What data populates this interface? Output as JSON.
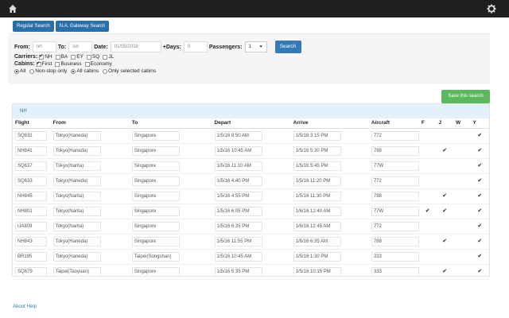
{
  "topbar": {
    "home_icon": "home-icon",
    "settings_icon": "gear-icon"
  },
  "tabs": [
    {
      "label": "Regular Search"
    },
    {
      "label": "N.A. Gateway Search"
    }
  ],
  "search": {
    "from_label": "From:",
    "from_value": "nrt",
    "to_label": "To:",
    "to_value": "sin",
    "date_label": "Date:",
    "date_value": "01/05/2016",
    "days_label": "+Days:",
    "days_value": "0",
    "passengers_label": "Passengers:",
    "passengers_value": "1",
    "search_button": "Search"
  },
  "carriers": {
    "label": "Carriers:",
    "items": [
      {
        "code": "NH",
        "checked": true
      },
      {
        "code": "BA",
        "checked": false
      },
      {
        "code": "EY",
        "checked": false
      },
      {
        "code": "SQ",
        "checked": false
      },
      {
        "code": "JL",
        "checked": false
      }
    ]
  },
  "cabins": {
    "label": "Cabins:",
    "items": [
      {
        "name": "First",
        "checked": true
      },
      {
        "name": "Business",
        "checked": false
      },
      {
        "name": "Economy",
        "checked": false
      }
    ]
  },
  "filters": {
    "stops": [
      {
        "label": "All",
        "selected": true
      },
      {
        "label": "Non-stop only",
        "selected": false
      }
    ],
    "cabin_mode": [
      {
        "label": "All cabins",
        "selected": true
      },
      {
        "label": "Only selected cabins",
        "selected": false
      }
    ]
  },
  "save_button": "Save this search",
  "results": {
    "carrier": "NH",
    "columns": [
      "Flight",
      "From",
      "To",
      "Depart",
      "Arrive",
      "Aircraft",
      "F",
      "J",
      "W",
      "Y"
    ],
    "rows": [
      {
        "flight": "SQ631",
        "from": "Tokyo(Haneda)",
        "to": "Singapore",
        "depart": "1/5/16 8:50 AM",
        "arrive": "1/5/16 3:15 PM",
        "aircraft": "772",
        "F": "",
        "J": "",
        "W": "",
        "Y": "✔"
      },
      {
        "flight": "NH841",
        "from": "Tokyo(Haneda)",
        "to": "Singapore",
        "depart": "1/5/16 10:45 AM",
        "arrive": "1/5/16 5:30 PM",
        "aircraft": "788",
        "F": "",
        "J": "✔",
        "W": "",
        "Y": "✔"
      },
      {
        "flight": "SQ637",
        "from": "Tokyo(Narita)",
        "to": "Singapore",
        "depart": "1/5/16 11:10 AM",
        "arrive": "1/5/16 5:45 PM",
        "aircraft": "77W",
        "F": "",
        "J": "",
        "W": "",
        "Y": "✔"
      },
      {
        "flight": "SQ633",
        "from": "Tokyo(Haneda)",
        "to": "Singapore",
        "depart": "1/5/16 4:40 PM",
        "arrive": "1/5/16 11:20 PM",
        "aircraft": "772",
        "F": "",
        "J": "",
        "W": "",
        "Y": "✔"
      },
      {
        "flight": "NH845",
        "from": "Tokyo(Narita)",
        "to": "Singapore",
        "depart": "1/5/16 4:55 PM",
        "arrive": "1/5/16 11:30 PM",
        "aircraft": "788",
        "F": "",
        "J": "✔",
        "W": "",
        "Y": "✔"
      },
      {
        "flight": "NH801",
        "from": "Tokyo(Narita)",
        "to": "Singapore",
        "depart": "1/5/16 6:05 PM",
        "arrive": "1/6/16 12:40 AM",
        "aircraft": "77W",
        "F": "✔",
        "J": "✔",
        "W": "",
        "Y": "✔"
      },
      {
        "flight": "UA809",
        "from": "Tokyo(Narita)",
        "to": "Singapore",
        "depart": "1/5/16 6:35 PM",
        "arrive": "1/6/16 12:45 AM",
        "aircraft": "772",
        "F": "",
        "J": "",
        "W": "",
        "Y": "✔"
      },
      {
        "flight": "NH843",
        "from": "Tokyo(Haneda)",
        "to": "Singapore",
        "depart": "1/5/16 11:55 PM",
        "arrive": "1/6/16 6:35 AM",
        "aircraft": "788",
        "F": "",
        "J": "✔",
        "W": "",
        "Y": "✔"
      },
      {
        "flight": "BR195",
        "from": "Tokyo(Haneda)",
        "to": "Taipei(Songshan)",
        "depart": "1/5/16 10:45 AM",
        "arrive": "1/5/16 1:30 PM",
        "aircraft": "333",
        "F": "",
        "J": "",
        "W": "",
        "Y": "✔"
      },
      {
        "flight": "SQ879",
        "from": "Taipei(Taoyuan)",
        "to": "Singapore",
        "depart": "1/5/16 5:35 PM",
        "arrive": "1/5/16 10:15 PM",
        "aircraft": "333",
        "F": "",
        "J": "✔",
        "W": "",
        "Y": "✔"
      }
    ]
  },
  "footer": {
    "about": "About",
    "help": "Help"
  }
}
